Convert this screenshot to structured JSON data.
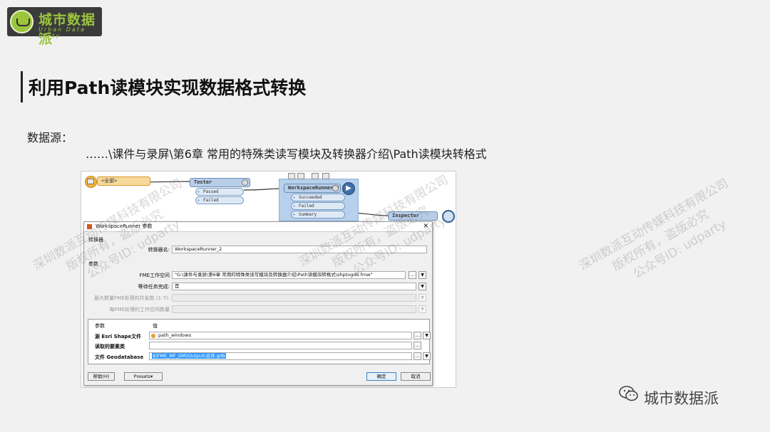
{
  "logo": {
    "name": "城市数据派",
    "subtitle": "Urban Data Party"
  },
  "slide": {
    "title": "利用Path读模块实现数据格式转换",
    "source_label": "数据源：",
    "source_path": "……\\课件与录屏\\第6章 常用的特殊类读写模块及转换器介绍\\Path读模块转格式"
  },
  "workflow": {
    "reader_label": "<全部>",
    "tester": {
      "label": "Tester",
      "ports": [
        "Passed",
        "Failed"
      ]
    },
    "runner": {
      "label": "WorkspaceRunner_2",
      "ports": [
        "Succeeded",
        "Failed",
        "Summary"
      ]
    },
    "inspector": {
      "label": "Inspector"
    }
  },
  "dialog": {
    "title": "WorkspaceRunner 参数",
    "close_label": "✕",
    "group_transformer": "转换器",
    "transformer_name_label": "转换器名:",
    "transformer_name": "WorkspaceRunner_2",
    "group_params": "参数",
    "fme_workspace_label": "FME工作空间",
    "fme_workspace_value": "\"G:\\课件与录屏\\第6章 常用的特殊类读写模块及转换器介绍\\Path读模块转格式\\shptogdb.fmw\"",
    "wait_label": "等待任务完成:",
    "wait_value": "是",
    "max_fme_label": "最大数量FME处理的并发数 (1-7):",
    "per_fme_label": "每FME处理的工作空间数量",
    "col_param": "参数",
    "col_value": "值",
    "row1_label": "源 Esri Shape文件",
    "row1_value": "path_windows",
    "row2_label": "读取的要素类",
    "row2_value": "",
    "row3_label": "文件 Geodatabase",
    "row3_value": "$(FME_MF_DIR)Output\\合并.gdb",
    "ellipsis": "...",
    "dropdown": "▼",
    "help_button": "帮助(H)",
    "presets_button": "Presets▾",
    "ok_button": "确定",
    "cancel_button": "取消"
  },
  "watermark": {
    "line1": "深圳数派互动传媒科技有限公司",
    "line2": "版权所有，盗版必究",
    "line3": "公众号ID: udparty"
  },
  "footer": {
    "text": "城市数据派"
  }
}
